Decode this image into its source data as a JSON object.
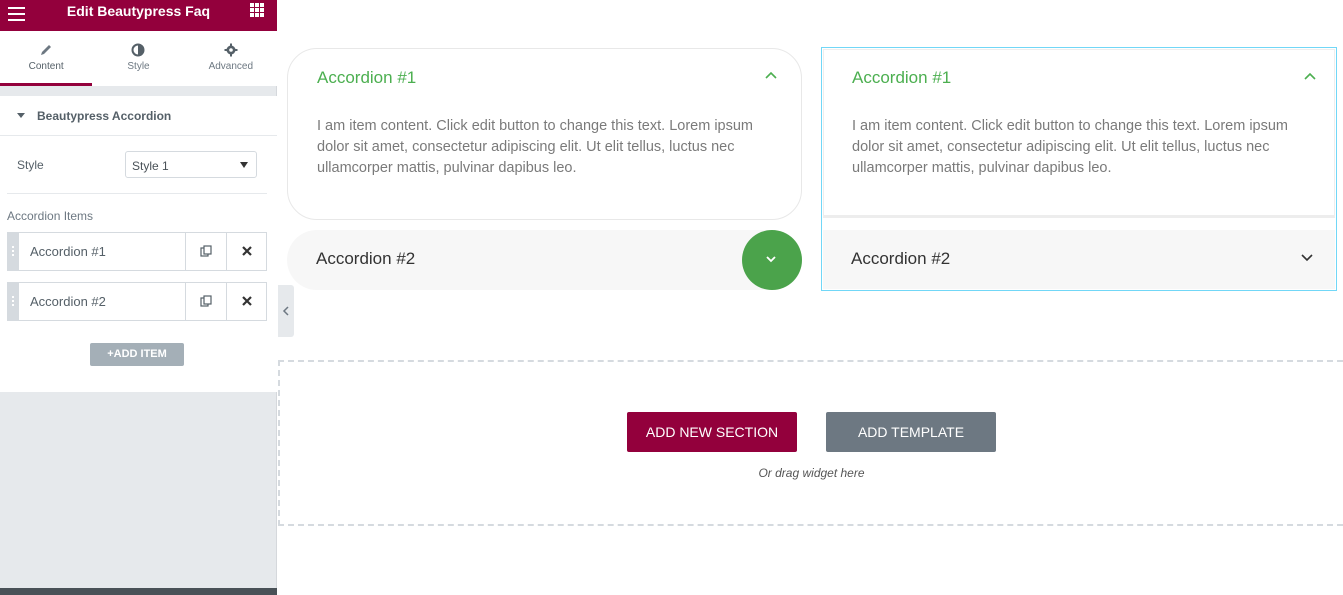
{
  "panel": {
    "header_title": "Edit Beautypress Faq",
    "tabs": [
      {
        "label": "Content",
        "icon": "pencil-icon",
        "active": true
      },
      {
        "label": "Style",
        "icon": "half-circle-icon",
        "active": false
      },
      {
        "label": "Advanced",
        "icon": "gear-icon",
        "active": false
      }
    ],
    "section_title": "Beautypress Accordion",
    "style_label": "Style",
    "style_value": "Style 1",
    "items_label": "Accordion Items",
    "items": [
      {
        "title": "Accordion #1"
      },
      {
        "title": "Accordion #2"
      }
    ],
    "add_item_label": "+ADD ITEM"
  },
  "preview": {
    "accordion_a": {
      "item1_title": "Accordion #1",
      "item1_text": "I am item content. Click edit button to change this text. Lorem ipsum dolor sit amet, consectetur adipiscing elit. Ut elit tellus, luctus nec ullamcorper mattis, pulvinar dapibus leo.",
      "item2_title": "Accordion #2"
    },
    "accordion_b": {
      "item1_title": "Accordion #1",
      "item1_text": "I am item content. Click edit button to change this text. Lorem ipsum dolor sit amet, consectetur adipiscing elit. Ut elit tellus, luctus nec ullamcorper mattis, pulvinar dapibus leo.",
      "item2_title": "Accordion #2"
    }
  },
  "dropzone": {
    "add_section_label": "ADD NEW SECTION",
    "add_template_label": "ADD TEMPLATE",
    "hint": "Or drag widget here"
  },
  "colors": {
    "brand": "#93003c",
    "accent_green": "#4caf50",
    "selection_border": "#71d7f7"
  }
}
